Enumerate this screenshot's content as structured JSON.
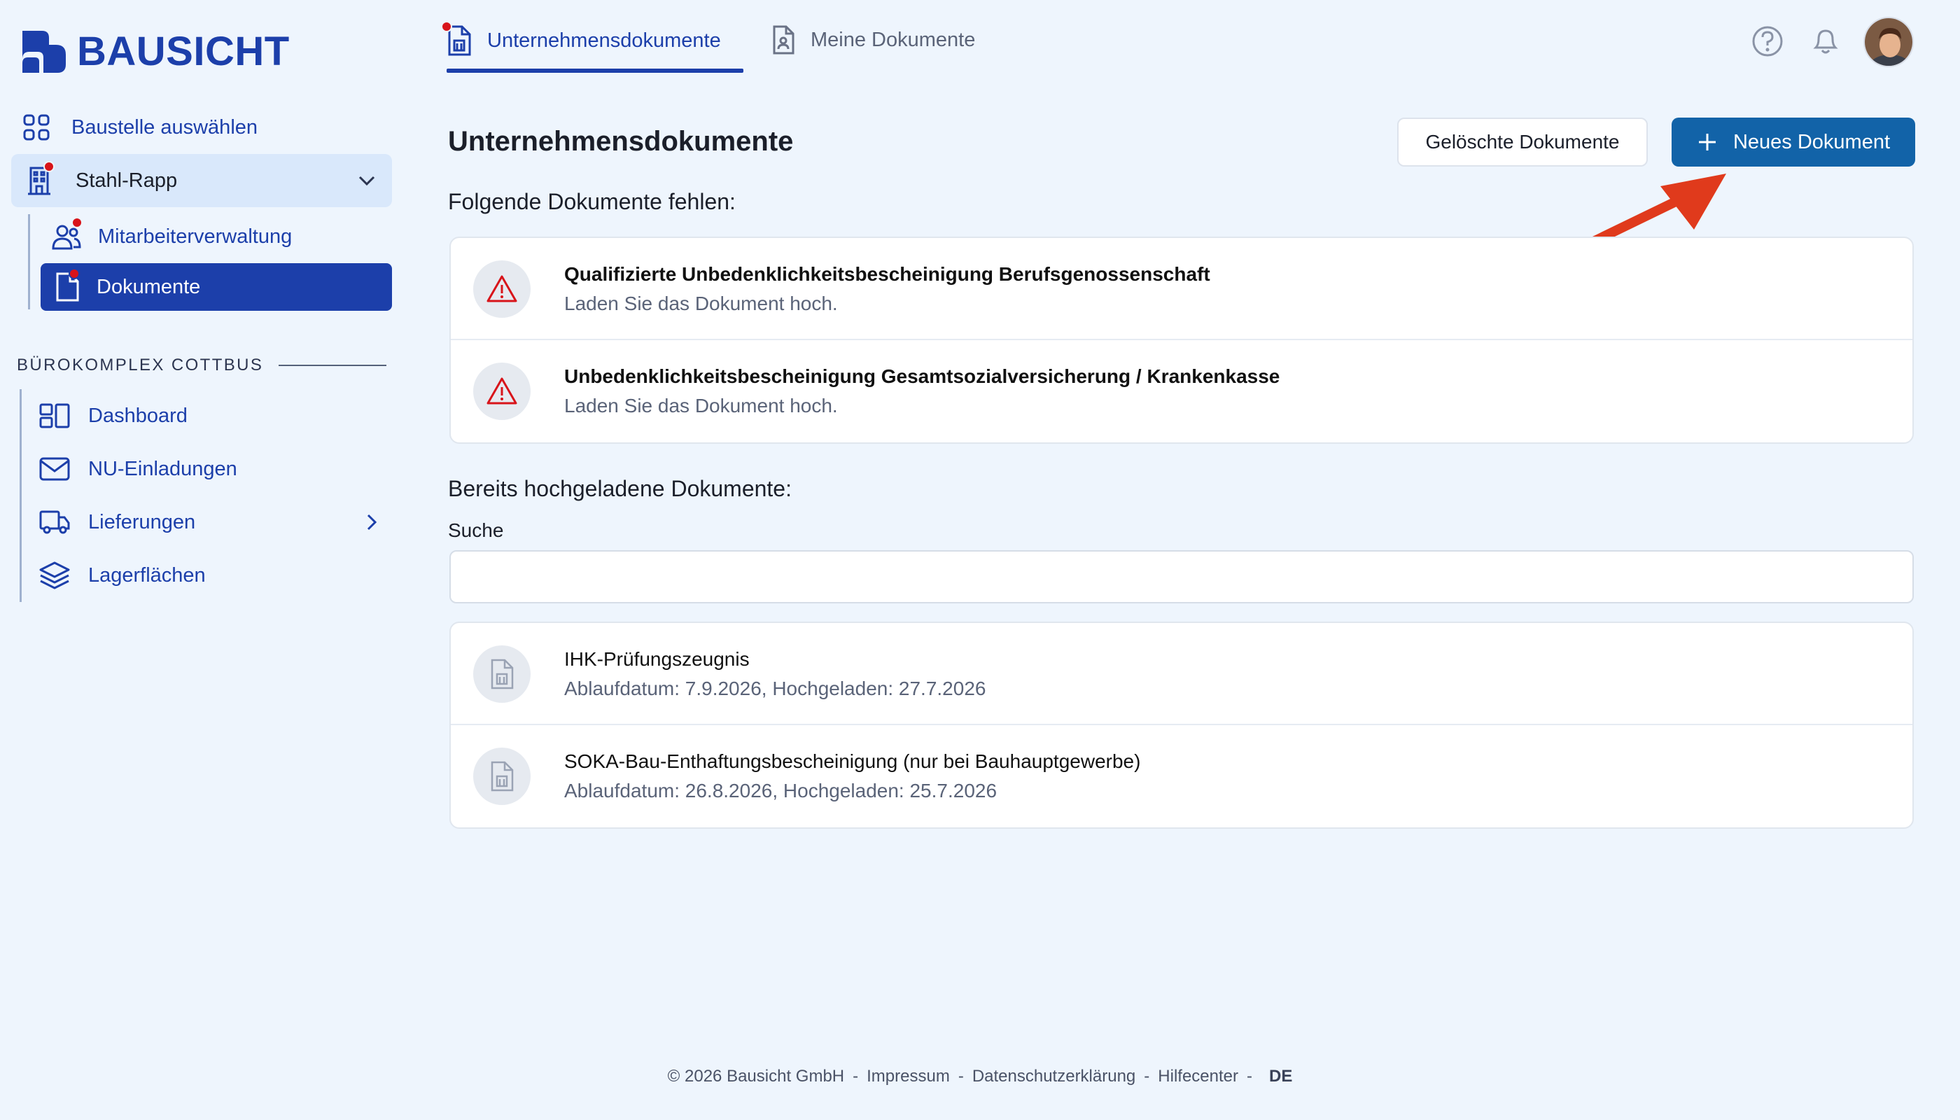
{
  "brand": {
    "name": "BAUSICHT"
  },
  "tabs": [
    {
      "label": "Unternehmensdokumente",
      "active": true
    },
    {
      "label": "Meine Dokumente",
      "active": false
    }
  ],
  "sidebar": {
    "select_site": "Baustelle auswählen",
    "site": "Stahl-Rapp",
    "site_items": [
      {
        "label": "Mitarbeiterverwaltung",
        "icon": "users-icon"
      },
      {
        "label": "Dokumente",
        "icon": "document-icon",
        "active": true
      }
    ],
    "section": "BÜROKOMPLEX COTTBUS",
    "section_items": [
      {
        "label": "Dashboard",
        "icon": "dashboard-icon"
      },
      {
        "label": "NU-Einladungen",
        "icon": "mail-icon"
      },
      {
        "label": "Lieferungen",
        "icon": "truck-icon"
      },
      {
        "label": "Lagerflächen",
        "icon": "layers-icon"
      }
    ]
  },
  "main": {
    "title": "Unternehmensdokumente",
    "deleted_button": "Gelöschte Dokumente",
    "new_button": "Neues Dokument",
    "missing_heading": "Folgende Dokumente fehlen:",
    "missing": [
      {
        "title": "Qualifizierte Unbedenklichkeitsbescheinigung Berufsgenossenschaft",
        "subtitle": "Laden Sie das Dokument hoch."
      },
      {
        "title": "Unbedenklichkeitsbescheinigung Gesamtsozialversicherung / Krankenkasse",
        "subtitle": "Laden Sie das Dokument hoch."
      }
    ],
    "uploaded_heading": "Bereits hochgeladene Dokumente:",
    "search_label": "Suche",
    "search_value": "",
    "uploaded": [
      {
        "title": "IHK-Prüfungszeugnis",
        "subtitle": "Ablaufdatum: 7.9.2026, Hochgeladen: 27.7.2026"
      },
      {
        "title": "SOKA-Bau-Enthaftungsbescheinigung (nur bei Bauhauptgewerbe)",
        "subtitle": "Ablaufdatum: 26.8.2026, Hochgeladen: 25.7.2026"
      }
    ]
  },
  "footer": {
    "copyright": "© 2026 Bausicht GmbH",
    "links": [
      "Impressum",
      "Datenschutzerklärung",
      "Hilfecenter"
    ],
    "language": "DE"
  },
  "colors": {
    "primary": "#1c3faa",
    "accent_button": "#1263a8",
    "alert": "#d8141a",
    "background": "#eef5fd"
  }
}
